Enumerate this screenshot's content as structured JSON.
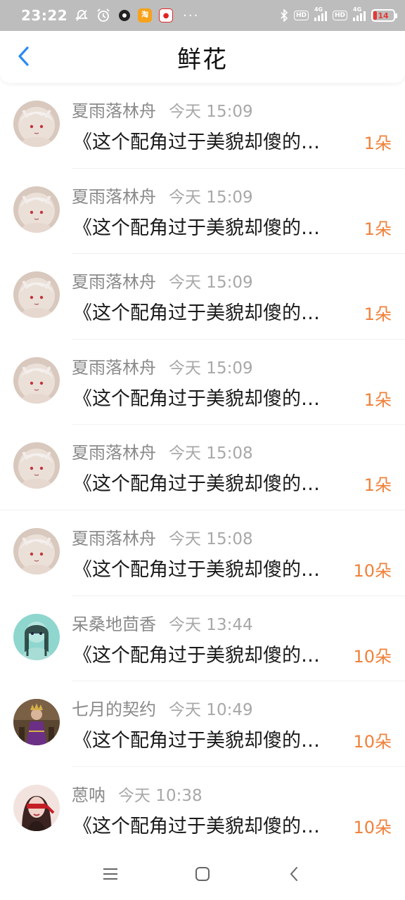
{
  "status_bar": {
    "time": "23:22",
    "battery": "14",
    "network_1": "4G",
    "network_2": "4G",
    "hd_label": "HD",
    "more": "···",
    "app_icons": [
      "mute-icon",
      "alarm-icon",
      "app-icon",
      "taobao-icon",
      "redbag-icon"
    ]
  },
  "header": {
    "title": "鲜花",
    "back_icon": "chevron-left-icon"
  },
  "colors": {
    "accent": "#2a8bf2",
    "count": "#f0813a",
    "status_bar_bg": "#bdbdbd"
  },
  "rows": [
    {
      "name": "夏雨落林舟",
      "time": "今天 15:09",
      "message": "《这个配角过于美貌却傻的…",
      "count": "1朵",
      "avatar": "avatar-anime-white"
    },
    {
      "name": "夏雨落林舟",
      "time": "今天 15:09",
      "message": "《这个配角过于美貌却傻的…",
      "count": "1朵",
      "avatar": "avatar-anime-white"
    },
    {
      "name": "夏雨落林舟",
      "time": "今天 15:09",
      "message": "《这个配角过于美貌却傻的…",
      "count": "1朵",
      "avatar": "avatar-anime-white"
    },
    {
      "name": "夏雨落林舟",
      "time": "今天 15:09",
      "message": "《这个配角过于美貌却傻的…",
      "count": "1朵",
      "avatar": "avatar-anime-white"
    },
    {
      "name": "夏雨落林舟",
      "time": "今天 15:08",
      "message": "《这个配角过于美貌却傻的…",
      "count": "1朵",
      "avatar": "avatar-anime-white"
    },
    {
      "name": "夏雨落林舟",
      "time": "今天 15:08",
      "message": "《这个配角过于美貌却傻的…",
      "count": "10朵",
      "avatar": "avatar-anime-white"
    },
    {
      "name": "呆桑地茴香",
      "time": "今天 13:44",
      "message": "《这个配角过于美貌却傻的…",
      "count": "10朵",
      "avatar": "avatar-teal-girl"
    },
    {
      "name": "七月的契约",
      "time": "今天 10:49",
      "message": "《这个配角过于美貌却傻的…",
      "count": "10朵",
      "avatar": "avatar-purple-queen"
    },
    {
      "name": "蒽呐",
      "time": "今天 10:38",
      "message": "《这个配角过于美貌却傻的…",
      "count": "10朵",
      "avatar": "avatar-red-blindfold"
    }
  ],
  "nav_bar": {
    "menu_icon": "menu-icon",
    "home_icon": "home-icon",
    "back_icon": "back-icon"
  }
}
